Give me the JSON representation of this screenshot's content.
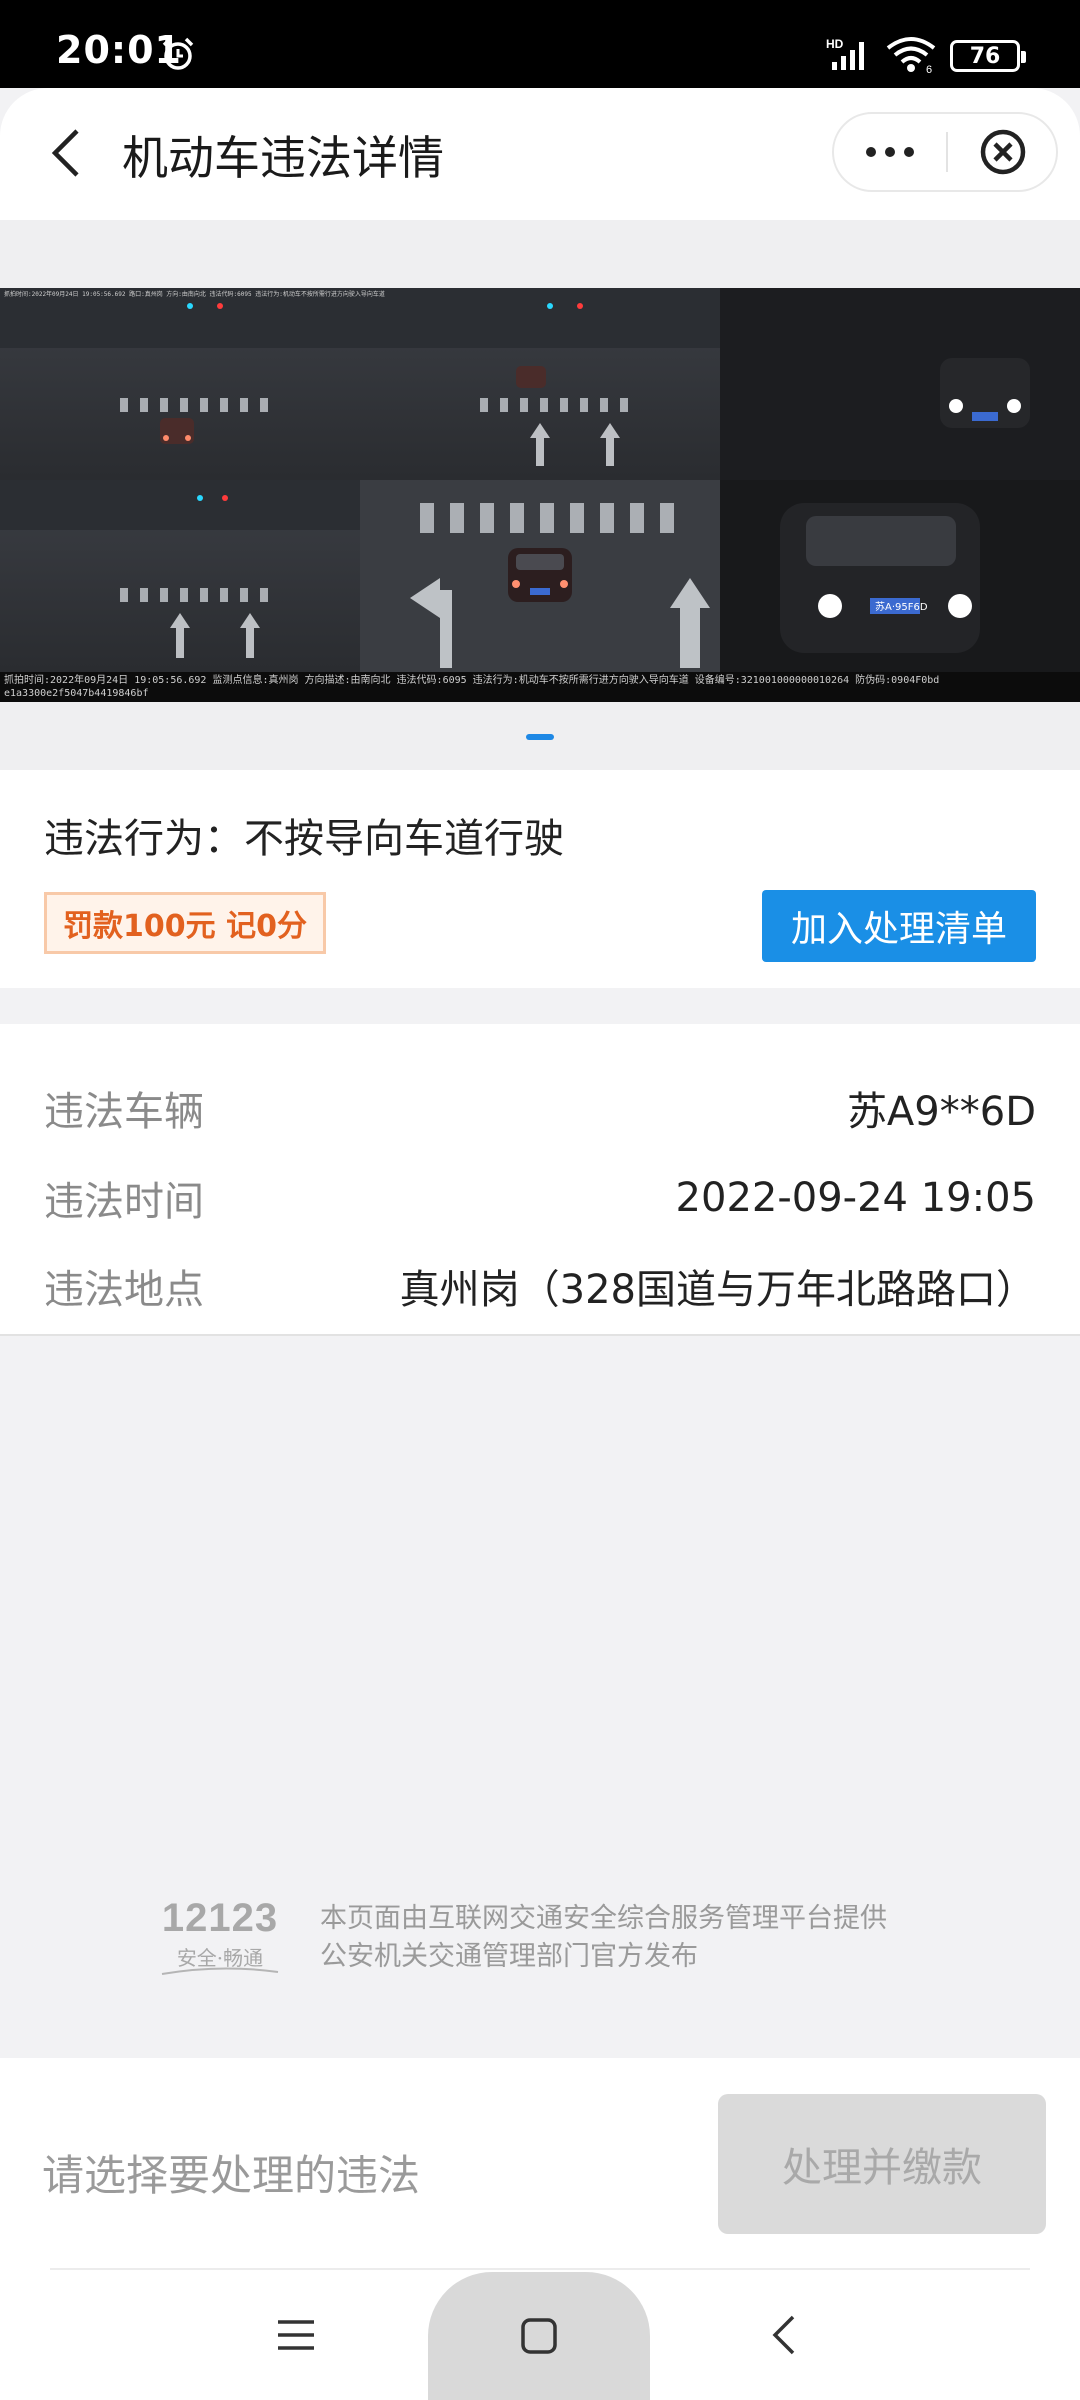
{
  "status_bar": {
    "time": "20:01",
    "battery": "76",
    "icons": [
      "alarm-icon",
      "signal-icon",
      "wifi-icon",
      "battery-icon"
    ]
  },
  "header": {
    "title": "机动车违法详情",
    "back_icon": "chevron-left-icon",
    "more_icon": "more-dots-icon",
    "close_icon": "close-circle-icon"
  },
  "photo": {
    "overlay_top": "抓拍时间:2022年09月24日 19:05:56.692 路口:真州岗 方向:由南向北 违法代码:6095 违法行为:机动车不按所需行进方向驶入导向车道",
    "overlay_bottom": "抓拍时间:2022年09月24日 19:05:56.692    监测点信息:真州岗    方向描述:由南向北    违法代码:6095    违法行为:机动车不按所需行进方向驶入导向车道    设备编号:321001000000010264    防伪码:0904F0bd",
    "overlay_bottom2": "e1a3300e2f5047b4419846bf",
    "plate_text": "苏A·95F6D",
    "page_count": 1,
    "active_page": 0
  },
  "violation": {
    "behavior": "违法行为：不按导向车道行驶",
    "penalty": "罚款100元 记0分",
    "add_button": "加入处理清单"
  },
  "details": {
    "rows": [
      {
        "label": "违法车辆",
        "value": "苏A9**6D"
      },
      {
        "label": "违法时间",
        "value": "2022-09-24 19:05"
      },
      {
        "label": "违法地点",
        "value": "真州岗（328国道与万年北路路口）"
      }
    ]
  },
  "footer": {
    "brand_number": "12123",
    "brand_slogan": "安全·畅通",
    "line1": "本页面由互联网交通安全综合服务管理平台提供",
    "line2": "公安机关交通管理部门官方发布"
  },
  "bottom_bar": {
    "hint": "请选择要处理的违法",
    "pay_button": "处理并缴款"
  },
  "nav": {
    "icons": [
      "menu-icon",
      "home-square-icon",
      "back-arrow-icon"
    ]
  },
  "colors": {
    "accent": "#1a8fe6",
    "penalty_text": "#e2611f",
    "penalty_bg": "#fff3ea",
    "disabled_button": "#dadada"
  }
}
